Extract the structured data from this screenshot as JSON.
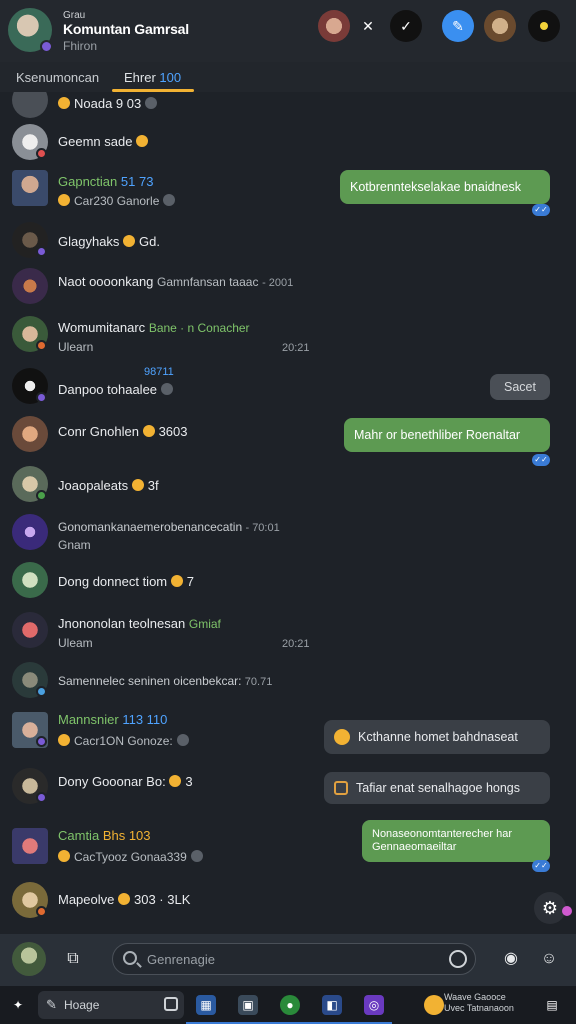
{
  "header": {
    "subtitle": "Grau",
    "title": "Komuntan Gamrsal",
    "status": "Fhiron"
  },
  "tabs": [
    {
      "label": "Ksenumoncan"
    },
    {
      "label": "Ehrer",
      "count": "100"
    }
  ],
  "messages": [
    {
      "name": "Noada 9 03",
      "sub": ""
    },
    {
      "name": "Geemn sade",
      "sub": ""
    },
    {
      "name": "Gapnctian",
      "tag": "51 73",
      "sub": "Car230 Ganorle"
    },
    {
      "name": "Glagyhaks",
      "tag": "Gd.",
      "sub": ""
    },
    {
      "name": "Naot oooonkang",
      "meta": "Gamnfansan taaac",
      "time": "- 2001",
      "sub": ""
    },
    {
      "name": "Womumitanarc",
      "tag": "Bane · n Conacher",
      "sub": "Ulearn",
      "time": "20:21"
    },
    {
      "name": "Danpoo tohaalee",
      "tag": "98711",
      "sub": ""
    },
    {
      "name": "Conr Gnohlen",
      "tag": "3603",
      "sub": ""
    },
    {
      "name": "Joaopaleats",
      "tag": "3f",
      "sub": ""
    },
    {
      "name": "Gonomankanaemerobenancecatin",
      "time": "- 70:01",
      "sub": "Gnam"
    },
    {
      "name": "Dong donnect tiom",
      "tag": "7",
      "sub": ""
    },
    {
      "name": "Jnononolan teolnesan",
      "tag": "Gmiaf",
      "sub": "Uleam",
      "time": "20:21"
    },
    {
      "name": "Samennelec seninen oicenbekcar:",
      "time": "70.71",
      "sub": ""
    },
    {
      "name": "Mannsnier",
      "tag": "113 110",
      "sub": "Cacr1ON Gonoze:"
    },
    {
      "name": "Dony Gooonar Bo:",
      "tag": "3",
      "sub": ""
    },
    {
      "name": "Camtia",
      "tag": "Bhs 103",
      "sub": "CacTyooz Gonaa339"
    },
    {
      "name": "Mapeolve",
      "tag": "303 · 3LK",
      "sub": ""
    }
  ],
  "bubbles": [
    {
      "text": "Kotbrenntekselakae bnaidnesk",
      "kind": "out"
    },
    {
      "text": "Sacet",
      "kind": "pill"
    },
    {
      "text": "Mahr or benethliber Roenaltar",
      "kind": "out"
    },
    {
      "text": "Kcthanne homet bahdnaseat",
      "kind": "in"
    },
    {
      "text": "Tafiar enat senalhagoe hongs",
      "kind": "in"
    },
    {
      "text": "Nonaseonomtanterecher har",
      "text2": "Gennaeomaeiltar",
      "kind": "out"
    }
  ],
  "composer": {
    "placeholder": "Genrenagie"
  },
  "taskbar": {
    "search_label": "Hoage",
    "notif_line1": "Waave Gaooce",
    "notif_line2": "Uvec Tatnanaoon"
  },
  "colors": {
    "accent": "#f2b233",
    "bubble_out": "#5d9a52",
    "link_blue": "#4fa3ff",
    "background": "#1e2228"
  }
}
